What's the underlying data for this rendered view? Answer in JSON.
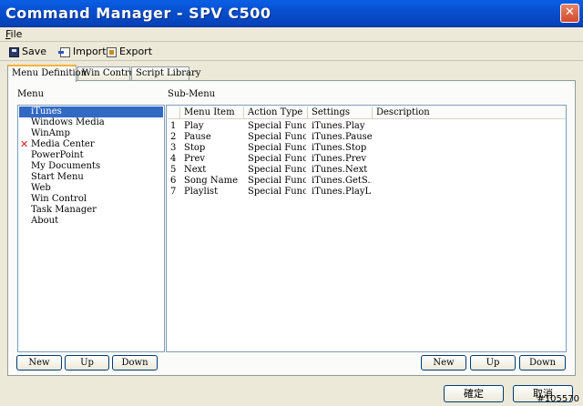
{
  "window": {
    "title": "Command Manager - SPV C500",
    "close_glyph": "✕"
  },
  "menubar": {
    "file": "File"
  },
  "toolbar": {
    "save": "Save",
    "import": "Import",
    "export": "Export"
  },
  "tabs": [
    {
      "label": "Menu Definition",
      "active": true
    },
    {
      "label": "Win Control",
      "active": false
    },
    {
      "label": "Script Library",
      "active": false
    }
  ],
  "menu_panel": {
    "label": "Menu",
    "items": [
      {
        "label": "iTunes",
        "selected": true,
        "marked": false
      },
      {
        "label": "Windows Media",
        "selected": false,
        "marked": false
      },
      {
        "label": "WinAmp",
        "selected": false,
        "marked": false
      },
      {
        "label": "Media Center",
        "selected": false,
        "marked": true
      },
      {
        "label": "PowerPoint",
        "selected": false,
        "marked": false
      },
      {
        "label": "My Documents",
        "selected": false,
        "marked": false
      },
      {
        "label": "Start Menu",
        "selected": false,
        "marked": false
      },
      {
        "label": "Web",
        "selected": false,
        "marked": false
      },
      {
        "label": "Win Control",
        "selected": false,
        "marked": false
      },
      {
        "label": "Task Manager",
        "selected": false,
        "marked": false
      },
      {
        "label": "About",
        "selected": false,
        "marked": false
      }
    ],
    "mark_glyph": "✕",
    "buttons": {
      "new": "New",
      "up": "Up",
      "down": "Down"
    }
  },
  "submenu_panel": {
    "label": "Sub-Menu",
    "columns": [
      "Menu Item",
      "Action Type",
      "Settings",
      "Description"
    ],
    "rows": [
      {
        "num": "1",
        "item": "Play",
        "action": "Special Func...",
        "settings": "iTunes.Play",
        "description": ""
      },
      {
        "num": "2",
        "item": "Pause",
        "action": "Special Func...",
        "settings": "iTunes.Pause",
        "description": ""
      },
      {
        "num": "3",
        "item": "Stop",
        "action": "Special Func...",
        "settings": "iTunes.Stop",
        "description": ""
      },
      {
        "num": "4",
        "item": "Prev",
        "action": "Special Func...",
        "settings": "iTunes.Prev",
        "description": ""
      },
      {
        "num": "5",
        "item": "Next",
        "action": "Special Func...",
        "settings": "iTunes.Next",
        "description": ""
      },
      {
        "num": "6",
        "item": "Song Name",
        "action": "Special Func...",
        "settings": "iTunes.GetS...",
        "description": ""
      },
      {
        "num": "7",
        "item": "Playlist",
        "action": "Special Func...",
        "settings": "iTunes.PlayL...",
        "description": ""
      }
    ],
    "buttons": {
      "new": "New",
      "up": "Up",
      "down": "Down"
    }
  },
  "footer": {
    "ok": "確定",
    "cancel": "取消"
  },
  "watermark": "#105570",
  "colors": {
    "title_bar": "#0850d0",
    "selection": "#316ac5",
    "mark": "#d21e1e"
  }
}
